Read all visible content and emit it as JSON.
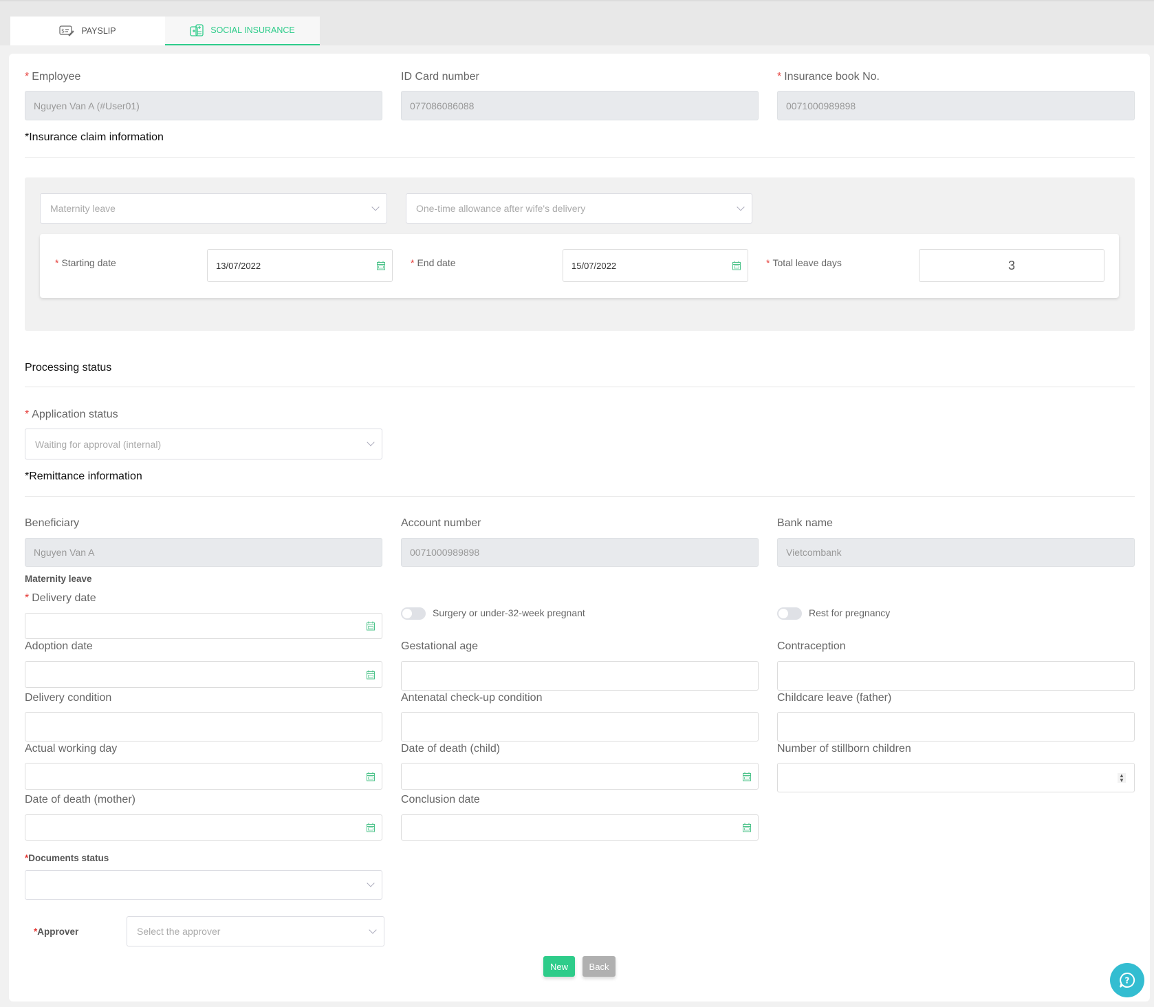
{
  "tabs": [
    {
      "label": "PAYSLIP",
      "icon": "payslip-icon",
      "active": false
    },
    {
      "label": "SOCIAL INSURANCE",
      "icon": "social-insurance-icon",
      "active": true
    }
  ],
  "colors": {
    "accent": "#2ecc8a",
    "required": "#e53935",
    "help": "#33bdd1",
    "back": "#b0b0b0"
  },
  "employee": {
    "employee_label": "Employee",
    "employee_value": "Nguyen Van A (#User01)",
    "id_card_label": "ID Card number",
    "id_card_value": "077086086088",
    "insurance_book_label": "Insurance book No.",
    "insurance_book_value": "0071000989898"
  },
  "claim": {
    "heading": "*Insurance claim information",
    "type_value": "Maternity leave",
    "subtype_value": "One-time allowance after wife's delivery",
    "starting_date_label": "Starting date",
    "starting_date_value": "13/07/2022",
    "end_date_label": "End date",
    "end_date_value": "15/07/2022",
    "total_leave_label": "Total leave days",
    "total_leave_value": "3"
  },
  "processing": {
    "heading": "Processing status",
    "application_status_label": "Application status",
    "application_status_value": "Waiting for approval (internal)"
  },
  "remittance": {
    "heading": "*Remittance information",
    "beneficiary_label": "Beneficiary",
    "beneficiary_value": "Nguyen Van A",
    "account_label": "Account number",
    "account_value": "0071000989898",
    "bank_label": "Bank name",
    "bank_value": "Vietcombank"
  },
  "maternity": {
    "subheading": "Maternity leave",
    "delivery_date_label": "Delivery date",
    "surgery_toggle_label": "Surgery or under-32-week pregnant",
    "surgery_toggle_on": false,
    "rest_toggle_label": "Rest for pregnancy",
    "rest_toggle_on": false,
    "adoption_date_label": "Adoption date",
    "gestational_age_label": "Gestational age",
    "contraception_label": "Contraception",
    "delivery_condition_label": "Delivery condition",
    "antenatal_label": "Antenatal check-up condition",
    "childcare_label": "Childcare leave (father)",
    "actual_working_label": "Actual working day",
    "death_child_label": "Date of death (child)",
    "stillborn_label": "Number of stillborn children",
    "death_mother_label": "Date of death (mother)",
    "conclusion_label": "Conclusion date"
  },
  "documents": {
    "label": "*Documents status",
    "value": ""
  },
  "approver": {
    "label": "*Approver",
    "placeholder": "Select the approver"
  },
  "actions": {
    "new_label": "New",
    "back_label": "Back"
  }
}
